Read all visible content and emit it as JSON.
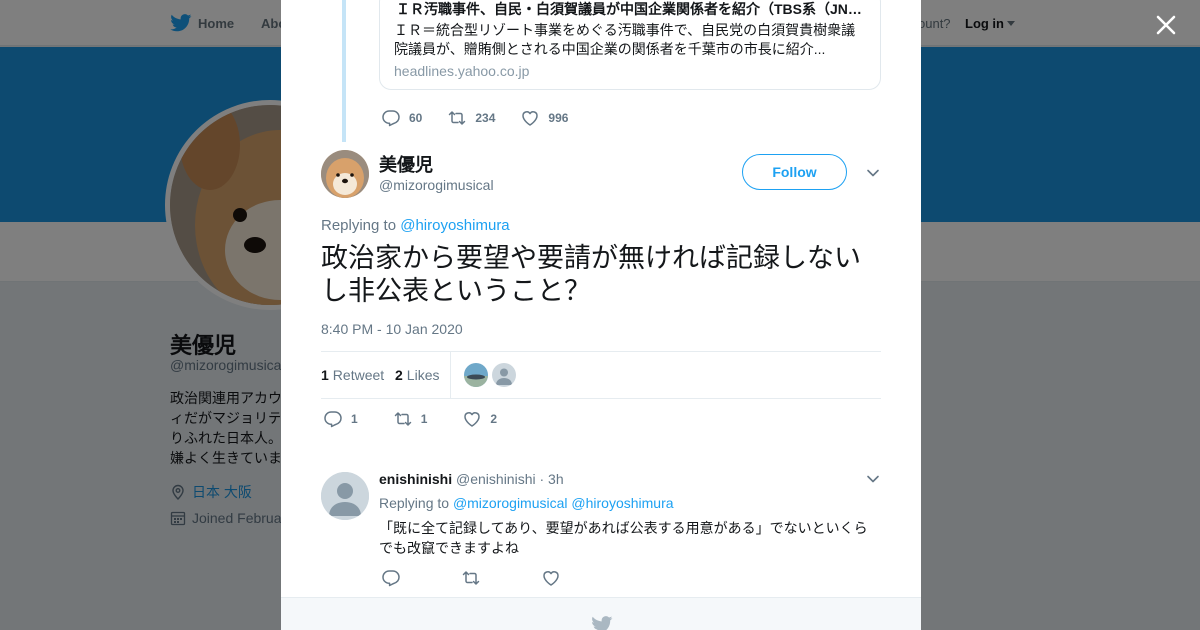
{
  "nav": {
    "home": "Home",
    "about": "Abo",
    "account_prompt": "ccount?",
    "login": "Log in"
  },
  "profile_bg": {
    "name": "美優児",
    "handle": "@mizorogimusica",
    "bio": "政治関連用アカウ\nィだがマジョリテ\nりふれた日本人。\n嫌よく生きていま",
    "location": "日本 大阪",
    "joined": "Joined Februa"
  },
  "quoted_card": {
    "title": "ＩＲ汚職事件、自民・白須賀議員が中国企業関係者を紹介（TBS系（JNN））",
    "description": "ＩＲ＝統合型リゾート事業をめぐる汚職事件で、自民党の白須賀貴樹衆議院議員が、贈賄側とされる中国企業の関係者を千葉市の市長に紹介...",
    "domain": "headlines.yahoo.co.jp"
  },
  "prev_actions": {
    "replies": "60",
    "retweets": "234",
    "likes": "996"
  },
  "tweet": {
    "name": "美優児",
    "handle": "@mizorogimusical",
    "follow": "Follow",
    "replying_prefix": "Replying to ",
    "replying_to": "@hiroyoshimura",
    "text": "政治家から要望や要請が無ければ記録しないし非公表ということ？",
    "time": "8:40 PM - 10 Jan 2020",
    "retweet_count": "1",
    "retweet_label": "Retweet",
    "like_count": "2",
    "like_label": "Likes",
    "replies": "1",
    "retweets": "1",
    "likes": "2"
  },
  "reply": {
    "name": "enishinishi",
    "handle": "@enishinishi",
    "time": "· 3h",
    "replying_prefix": "Replying to ",
    "replying_to_1": "@mizorogimusical",
    "replying_to_2": "@hiroyoshimura",
    "text": "「既に全て記録してあり、要望があれば公表する用意がある」でないといくらでも改竄できますよね"
  },
  "icons": {
    "brand": "twitter-bird-icon",
    "close": "close-icon",
    "reply": "reply-icon",
    "retweet": "retweet-icon",
    "like": "heart-icon",
    "more": "chevron-down-icon",
    "location": "location-pin-icon",
    "calendar": "calendar-icon"
  },
  "colors": {
    "brand_blue": "#1da1f2",
    "banner_blue": "#1b95e0",
    "muted": "#657786",
    "thread_line": "#c5e4f7"
  }
}
